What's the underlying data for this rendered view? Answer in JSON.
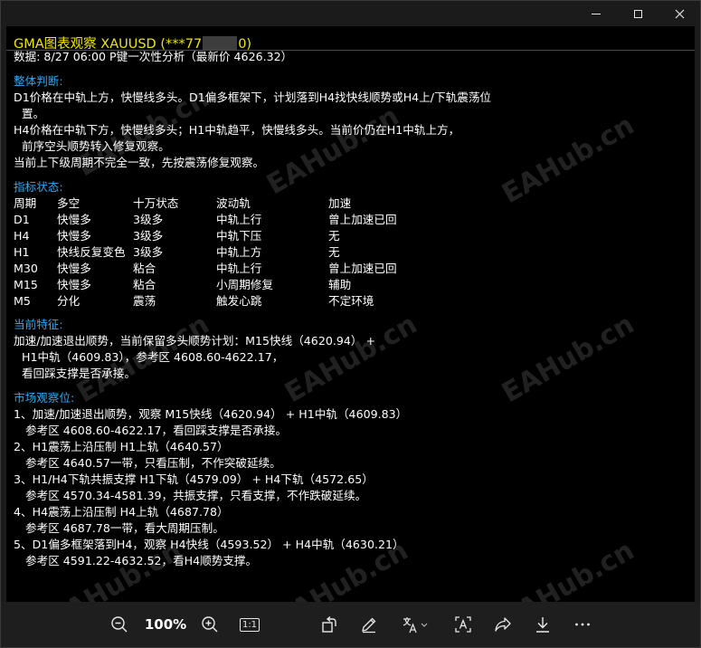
{
  "titlebar": {
    "minimize_icon": "minimize-icon",
    "maximize_icon": "maximize-icon",
    "close_icon": "close-icon"
  },
  "report": {
    "title": "GMA图表观察 XAUUSD (***77",
    "title_suffix": "0)",
    "data_line": "数据: 8/27 06:00   P键一次性分析（最新价 4626.32）",
    "overall_heading": "整体判断:",
    "overall_lines": [
      "D1价格在中轨上方，快慢线多头。D1偏多框架下，计划落到H4找快线顺势或H4上/下轨震荡位",
      "置。",
      "H4价格在中轨下方，快慢线多头；H1中轨趋平，快慢线多头。当前价仍在H1中轨上方，",
      "前序空头顺势转入修复观察。",
      "当前上下级周期不完全一致，先按震荡修复观察。"
    ],
    "indicator_heading": "指标状态:",
    "table_headers": [
      "周期",
      "多空",
      "十万状态",
      "波动轨",
      "加速"
    ],
    "table_rows": [
      [
        "D1",
        "快慢多",
        "3级多",
        "中轨上行",
        "曾上加速已回"
      ],
      [
        "H4",
        "快慢多",
        "3级多",
        "中轨下压",
        "无"
      ],
      [
        "H1",
        "快线反复变色",
        "3级多",
        "中轨上方",
        "无"
      ],
      [
        "M30",
        "快慢多",
        "粘合",
        "中轨上行",
        "曾上加速已回"
      ],
      [
        "M15",
        "快慢多",
        "粘合",
        "小周期修复",
        "辅助"
      ],
      [
        "M5",
        "分化",
        "震荡",
        "触发心跳",
        "不定环境"
      ]
    ],
    "feature_heading": "当前特征:",
    "feature_lines": [
      "加速/加速退出顺势，当前保留多头顺势计划：M15快线（4620.94） +",
      "H1中轨（4609.83），参考区 4608.60-4622.17，",
      "看回踩支撑是否承接。"
    ],
    "market_heading": "市场观察位:",
    "market_lines": [
      "1、加速/加速退出顺势，观察 M15快线（4620.94） + H1中轨（4609.83）",
      "参考区 4608.60-4622.17，看回踩支撑是否承接。",
      "2、H1震荡上沿压制 H1上轨（4640.57）",
      "参考区 4640.57一带，只看压制，不作突破延续。",
      "3、H1/H4下轨共振支撑 H1下轨（4579.09） + H4下轨（4572.65）",
      "参考区 4570.34-4581.39，共振支撑，只看支撑，不作跌破延续。",
      "4、H4震荡上沿压制 H4上轨（4687.78）",
      "参考区 4687.78一带，看大周期压制。",
      "5、D1偏多框架落到H4，观察 H4快线（4593.52） + H4中轨（4630.21）",
      "参考区 4591.22-4632.52，看H4顺势支撑。"
    ],
    "watermark": "EAHub.cn"
  },
  "toolbar": {
    "zoom_level": "100%",
    "zoom_out_icon": "zoom-out-icon",
    "zoom_in_icon": "zoom-in-icon",
    "actual_size_label": "1:1",
    "rotate_icon": "rotate-icon",
    "draw_icon": "pen-icon",
    "translate_icon": "translate-icon",
    "text_select_icon": "text-select-icon",
    "share_icon": "share-icon",
    "download_icon": "download-icon",
    "more_icon": "more-icon"
  },
  "colors": {
    "title_yellow": "#f0e500",
    "heading_blue": "#2fa8f0",
    "body_text": "#ffffff",
    "background": "#000000",
    "chrome": "#1b1b1b"
  }
}
